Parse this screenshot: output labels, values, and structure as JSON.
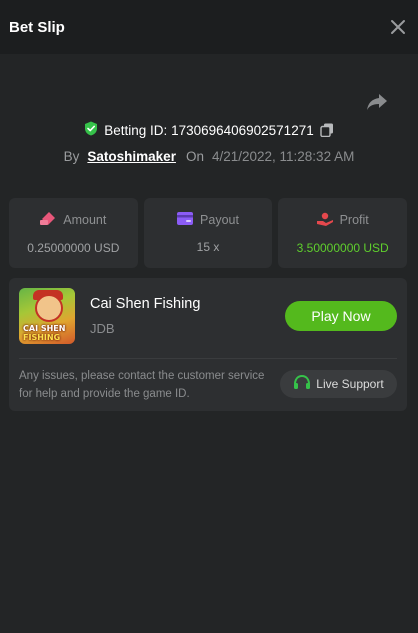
{
  "header": {
    "title": "Bet Slip"
  },
  "bet": {
    "id_label": "Betting ID: 1730696406902571271",
    "by_label": "By",
    "username": "Satoshimaker",
    "on_label": "On",
    "timestamp": "4/21/2022, 11:28:32 AM"
  },
  "stats": {
    "amount": {
      "label": "Amount",
      "value": "0.25000000 USD"
    },
    "payout": {
      "label": "Payout",
      "value": "15 x"
    },
    "profit": {
      "label": "Profit",
      "value": "3.50000000 USD"
    }
  },
  "game": {
    "name": "Cai Shen Fishing",
    "provider": "JDB",
    "thumb_line1": "CAI SHEN",
    "thumb_line2": "FISHING",
    "play_label": "Play Now"
  },
  "support": {
    "notice": "Any issues, please contact the customer service for help and provide the game ID.",
    "button_label": "Live Support"
  },
  "colors": {
    "accent_green": "#54b91d",
    "profit_green": "#5fcf2d",
    "amount_icon": "#e8577a",
    "payout_icon": "#8b5cf6",
    "profit_icon": "#e5484d",
    "verified_icon": "#36c24a"
  },
  "icons": [
    "close-icon",
    "share-icon",
    "verified-shield-icon",
    "copy-icon",
    "amount-icon",
    "payout-icon",
    "profit-icon",
    "headset-icon"
  ]
}
